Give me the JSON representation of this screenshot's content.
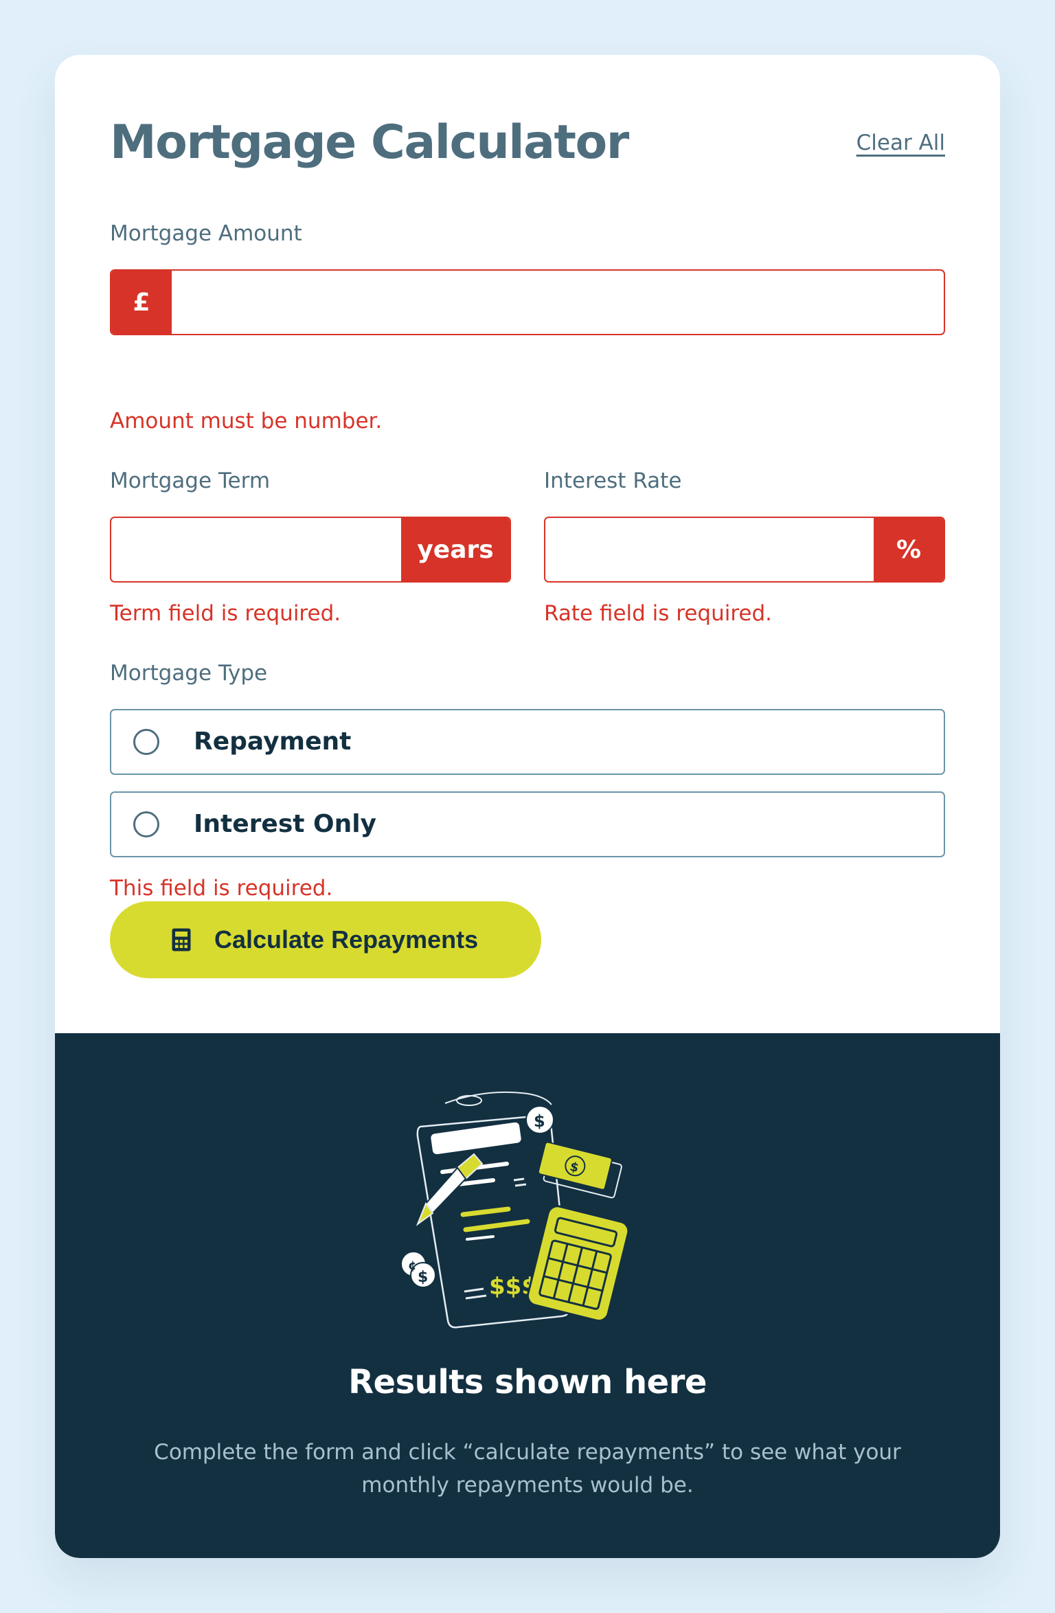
{
  "header": {
    "title": "Mortgage Calculator",
    "clear_label": "Clear All"
  },
  "amount": {
    "label": "Mortgage Amount",
    "prefix": "£",
    "value": "",
    "error": "Amount must be number."
  },
  "term": {
    "label": "Mortgage Term",
    "suffix": "years",
    "value": "",
    "error": "Term field is required."
  },
  "rate": {
    "label": "Interest Rate",
    "suffix": "%",
    "value": "",
    "error": "Rate field is required."
  },
  "type": {
    "label": "Mortgage Type",
    "options": [
      "Repayment",
      "Interest Only"
    ],
    "selected": null,
    "error": "This field is required."
  },
  "submit": {
    "label": "Calculate Repayments",
    "icon": "calculator-icon"
  },
  "results": {
    "title": "Results shown here",
    "description": "Complete the form and click “calculate repayments” to see what your monthly repayments would be."
  },
  "colors": {
    "error": "#d73328",
    "accent": "#d8db2f",
    "dark": "#133041",
    "slate": "#4e6e7e",
    "background": "#e0eff9"
  }
}
